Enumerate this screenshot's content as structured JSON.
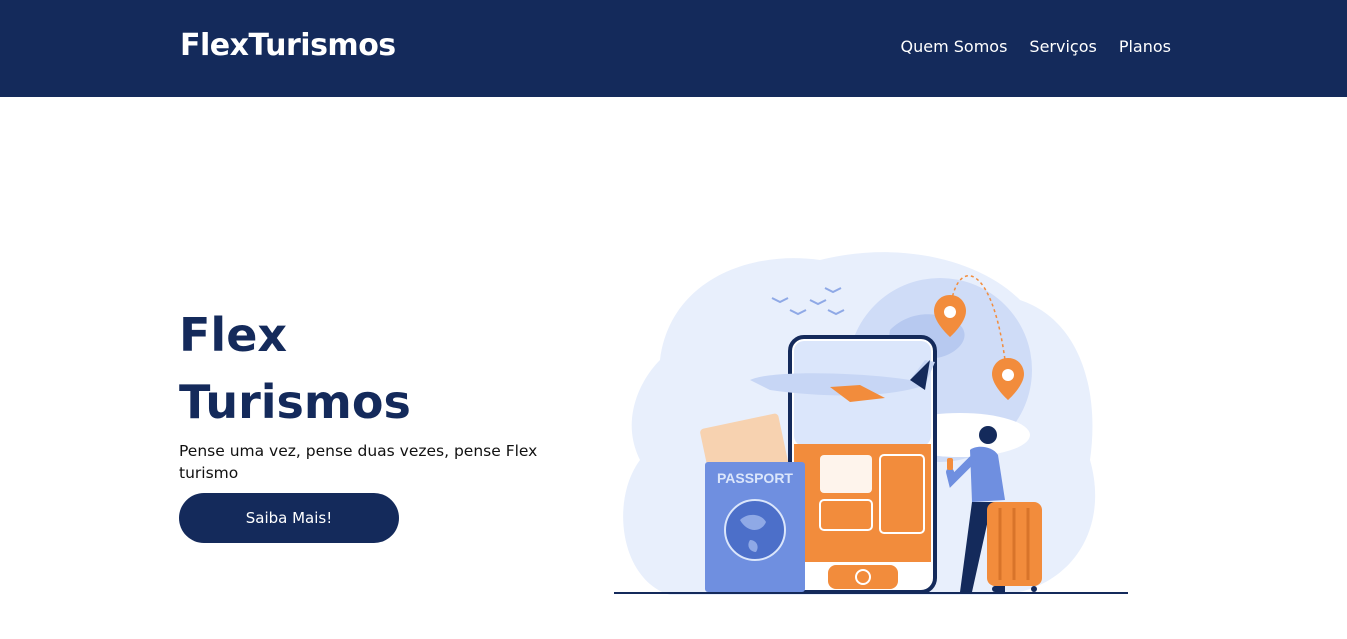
{
  "header": {
    "logo": "FlexTurismos",
    "nav": [
      "Quem Somos",
      "Serviços",
      "Planos"
    ]
  },
  "hero": {
    "title_line1": "Flex",
    "title_line2": "Turismos",
    "subtitle": "Pense uma vez, pense duas vezes, pense Flex turismo",
    "cta_label": "Saiba Mais!"
  },
  "illustration": {
    "passport_label": "PASSPORT"
  },
  "colors": {
    "brand_navy": "#142a5b",
    "accent_orange": "#f28c3c",
    "accent_blue": "#6f8fe0",
    "blob_light": "#e8effc"
  }
}
